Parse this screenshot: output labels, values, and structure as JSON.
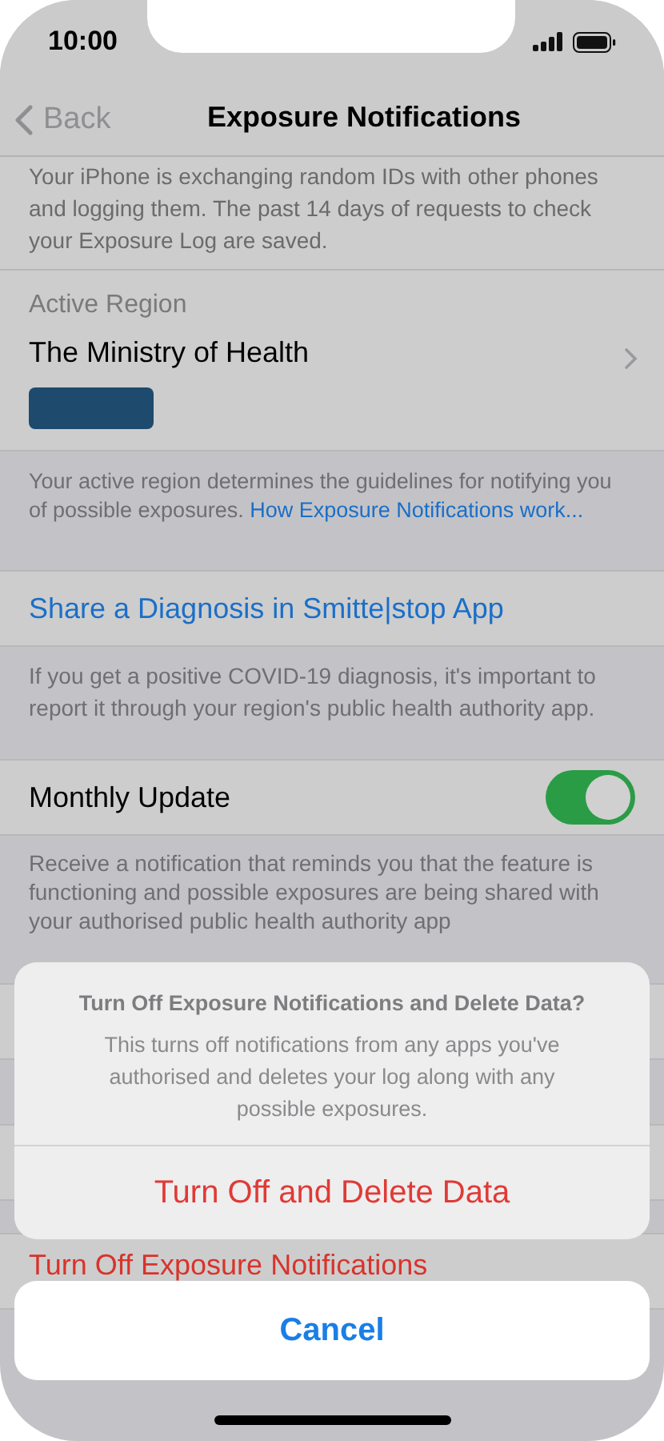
{
  "status_bar": {
    "time": "10:00"
  },
  "nav": {
    "back": "Back",
    "title": "Exposure Notifications"
  },
  "intro": "Your iPhone is exchanging random IDs with other phones and logging them. The past 14 days of requests to check your Exposure Log are saved.",
  "active_region": {
    "label": "Active Region",
    "value": "The Ministry of Health"
  },
  "region_footer": {
    "text": "Your active region determines the guidelines for notifying you of possible exposures.",
    "link": "How Exposure Notifications work..."
  },
  "share": {
    "label": "Share a Diagnosis in Smitte|stop App"
  },
  "share_footer": "If you get a positive COVID-19 diagnosis, it's important to report it through your region's public health authority app.",
  "monthly_update": {
    "label": "Monthly Update",
    "on": true
  },
  "monthly_footer": "Receive a notification that reminds you that the feature is functioning and possible exposures are being shared with your authorised public health authority app",
  "turn_off_row": "Turn Off Exposure Notifications",
  "action_sheet": {
    "title": "Turn Off Exposure Notifications and Delete Data?",
    "message": "This turns off notifications from any apps you've authorised and deletes your log along with any possible exposures.",
    "destructive": "Turn Off and Delete Data",
    "cancel": "Cancel"
  }
}
